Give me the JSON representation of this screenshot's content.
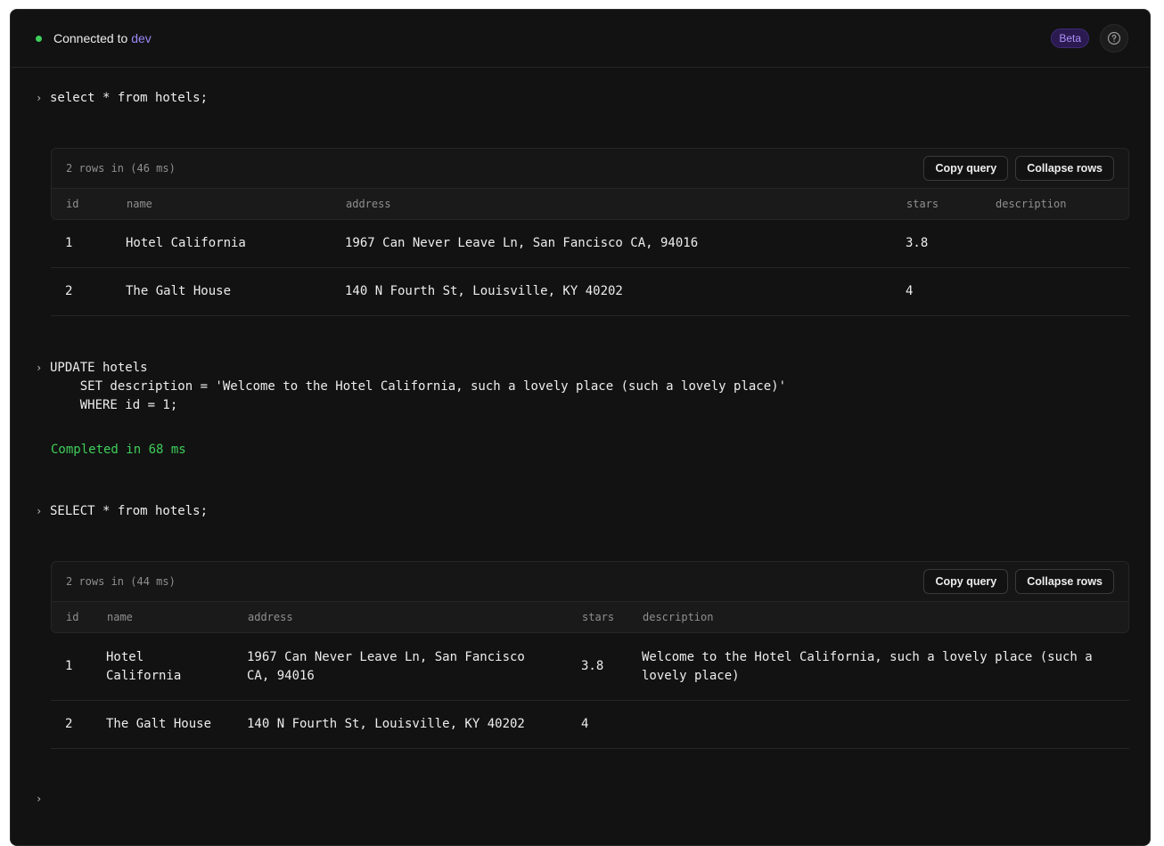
{
  "header": {
    "connected_prefix": "Connected to",
    "environment": "dev",
    "beta_label": "Beta",
    "help_icon": "question-circle-icon"
  },
  "prompt_symbol": "›",
  "blocks": [
    {
      "query_lines": [
        "select * from hotels;"
      ],
      "result": {
        "meta": "2 rows in (46 ms)",
        "copy_label": "Copy query",
        "collapse_label": "Collapse rows",
        "columns": [
          "id",
          "name",
          "address",
          "stars",
          "description"
        ],
        "rows": [
          [
            "1",
            "Hotel California",
            "1967 Can Never Leave Ln, San Fancisco CA, 94016",
            "3.8",
            ""
          ],
          [
            "2",
            "The Galt House",
            "140 N Fourth St, Louisville, KY 40202",
            "4",
            ""
          ]
        ]
      }
    },
    {
      "query_lines": [
        "UPDATE hotels",
        "    SET description = 'Welcome to the Hotel California, such a lovely place (such a lovely place)'",
        "    WHERE id = 1;"
      ],
      "status": "Completed in 68 ms"
    },
    {
      "query_lines": [
        "SELECT * from hotels;"
      ],
      "result": {
        "meta": "2 rows in (44 ms)",
        "copy_label": "Copy query",
        "collapse_label": "Collapse rows",
        "columns": [
          "id",
          "name",
          "address",
          "stars",
          "description"
        ],
        "rows": [
          [
            "1",
            "Hotel California",
            "1967 Can Never Leave Ln, San Fancisco CA, 94016",
            "3.8",
            "Welcome to the Hotel California, such a lovely place (such a lovely place)"
          ],
          [
            "2",
            "The Galt House",
            "140 N Fourth St, Louisville, KY 40202",
            "4",
            ""
          ]
        ]
      }
    }
  ],
  "input": {
    "value": ""
  }
}
